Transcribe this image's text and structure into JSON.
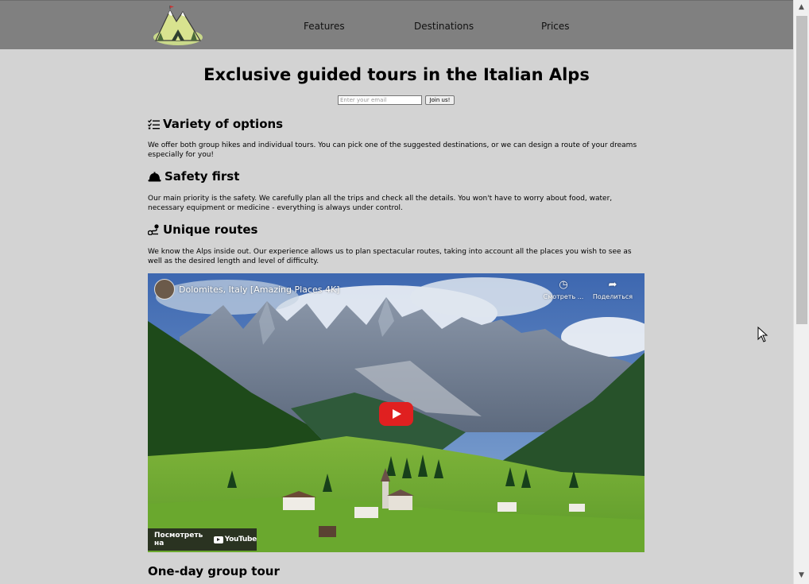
{
  "nav": {
    "logo_icon": "mountain-tent-logo",
    "links": [
      "Features",
      "Destinations",
      "Prices"
    ]
  },
  "main": {
    "title": "Exclusive guided tours in the Italian Alps",
    "form": {
      "email_placeholder": "Enter your email",
      "submit_label": "Join us!"
    },
    "sections": [
      {
        "icon": "checklist-icon",
        "heading": "Variety of options",
        "text": "We offer both group hikes and individual tours. You can pick one of the suggested destinations, or we can design a route of your dreams especially for you!"
      },
      {
        "icon": "helmet-icon",
        "heading": "Safety first",
        "text": "Our main priority is the safety. We carefully plan all the trips and check all the details. You won't have to worry about food, water, necessary equipment or medicine - everything is always under control."
      },
      {
        "icon": "route-icon",
        "heading": "Unique routes",
        "text": "We know the Alps inside out. Our experience allows us to plan spectacular routes, taking into account all the places you wish to see as well as the desired length and level of difficulty."
      }
    ],
    "video": {
      "title": "Dolomites, Italy [Amazing Places 4K]",
      "watch_later": "Смотреть ...",
      "share": "Поделиться",
      "watch_on": "Посмотреть на",
      "youtube": "YouTube"
    },
    "next_heading": "One-day group tour"
  },
  "colors": {
    "page_bg": "#d3d3d3",
    "header_bg": "#808080",
    "play_button": "#e02020"
  }
}
